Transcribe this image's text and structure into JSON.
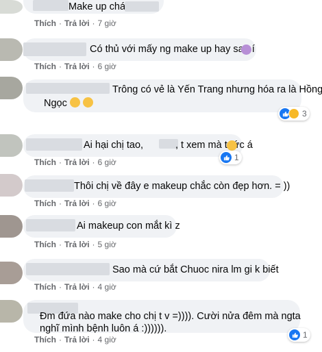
{
  "actions": {
    "like": "Thích",
    "reply": "Trả lời",
    "sep": "·"
  },
  "comments": [
    {
      "text": "Make up chán",
      "time": "7 giờ"
    },
    {
      "text": "Có thủ với mấy ng make up hay sao í",
      "emoji": "woman-gesturing-emoji",
      "time": "6 giờ"
    },
    {
      "text_line1": "Trông có vẻ là Yến Trang nhưng hóa ra là Hồng",
      "text_line2": "Ngọc",
      "emoji": "rofl-emoji",
      "reaction_count": "3",
      "time": "6 giờ"
    },
    {
      "text_a": "Ai hại chị tao,",
      "text_b": ", t xem mà t tức á",
      "emoji": "squinting-laugh-emoji",
      "reaction_count": "1",
      "time": "6 giờ"
    },
    {
      "text": "Thôi chị về đây e makeup chắc còn đẹp hơn. = ))",
      "time": "6 giờ"
    },
    {
      "text": "Ai makeup con mắt kì z",
      "time": "5 giờ"
    },
    {
      "text": "Sao mà cứ bắt Chuoc nira lm gi k biết",
      "time": "4 giờ"
    },
    {
      "text_line1": "Đm đứa nào make cho chị t v =)))). Cười nửa đêm mà ngta",
      "text_line2": "nghĩ mình bệnh luôn á :)))))).",
      "reaction_count": "1",
      "time": "4 giờ"
    }
  ],
  "colors": {
    "bubble": "#f0f2f5",
    "meta": "#65676b",
    "like": "#1877f2",
    "haha": "#f7b928"
  }
}
